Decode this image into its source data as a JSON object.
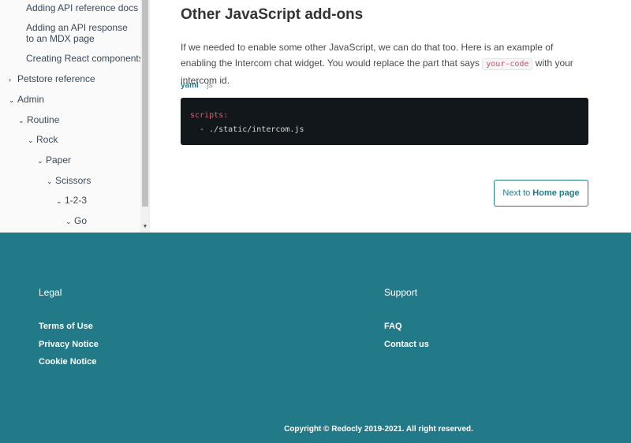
{
  "sidebar": {
    "items": [
      {
        "label": "Adding API reference docs",
        "chevron": ""
      },
      {
        "label": "Adding an API response to an MDX page",
        "chevron": ""
      },
      {
        "label": "Creating React components",
        "chevron": ""
      },
      {
        "label": "Petstore reference",
        "chevron": "›"
      },
      {
        "label": "Admin",
        "chevron": "⌄"
      },
      {
        "label": "Routine",
        "chevron": "⌄"
      },
      {
        "label": "Rock",
        "chevron": "⌄"
      },
      {
        "label": "Paper",
        "chevron": "⌄"
      },
      {
        "label": "Scissors",
        "chevron": "⌄"
      },
      {
        "label": "1-2-3",
        "chevron": "⌄"
      },
      {
        "label": "Go",
        "chevron": "⌄"
      }
    ]
  },
  "content": {
    "heading": "Other JavaScript add-ons",
    "para_before": "If we needed to enable some other JavaScript, we can do that too. Here is an example of enabling the Intercom chat widget. You would replace the part that says ",
    "inline_code": "your-code",
    "para_after": " with your intercom id.",
    "tabs": [
      {
        "label": "yaml",
        "active": true
      },
      {
        "label": "js",
        "active": false
      }
    ],
    "code": {
      "line1_key": "scripts:",
      "line2": "  - ./static/intercom.js"
    },
    "next": {
      "prefix": "Next to ",
      "target": "Home page"
    }
  },
  "footer": {
    "legal": {
      "heading": "Legal",
      "links": [
        "Terms of Use",
        "Privacy Notice",
        "Cookie Notice"
      ]
    },
    "support": {
      "heading": "Support",
      "links": [
        "FAQ",
        "Contact us"
      ]
    },
    "copyright": "Copyright © Redocly 2019-2021. All right reserved."
  }
}
